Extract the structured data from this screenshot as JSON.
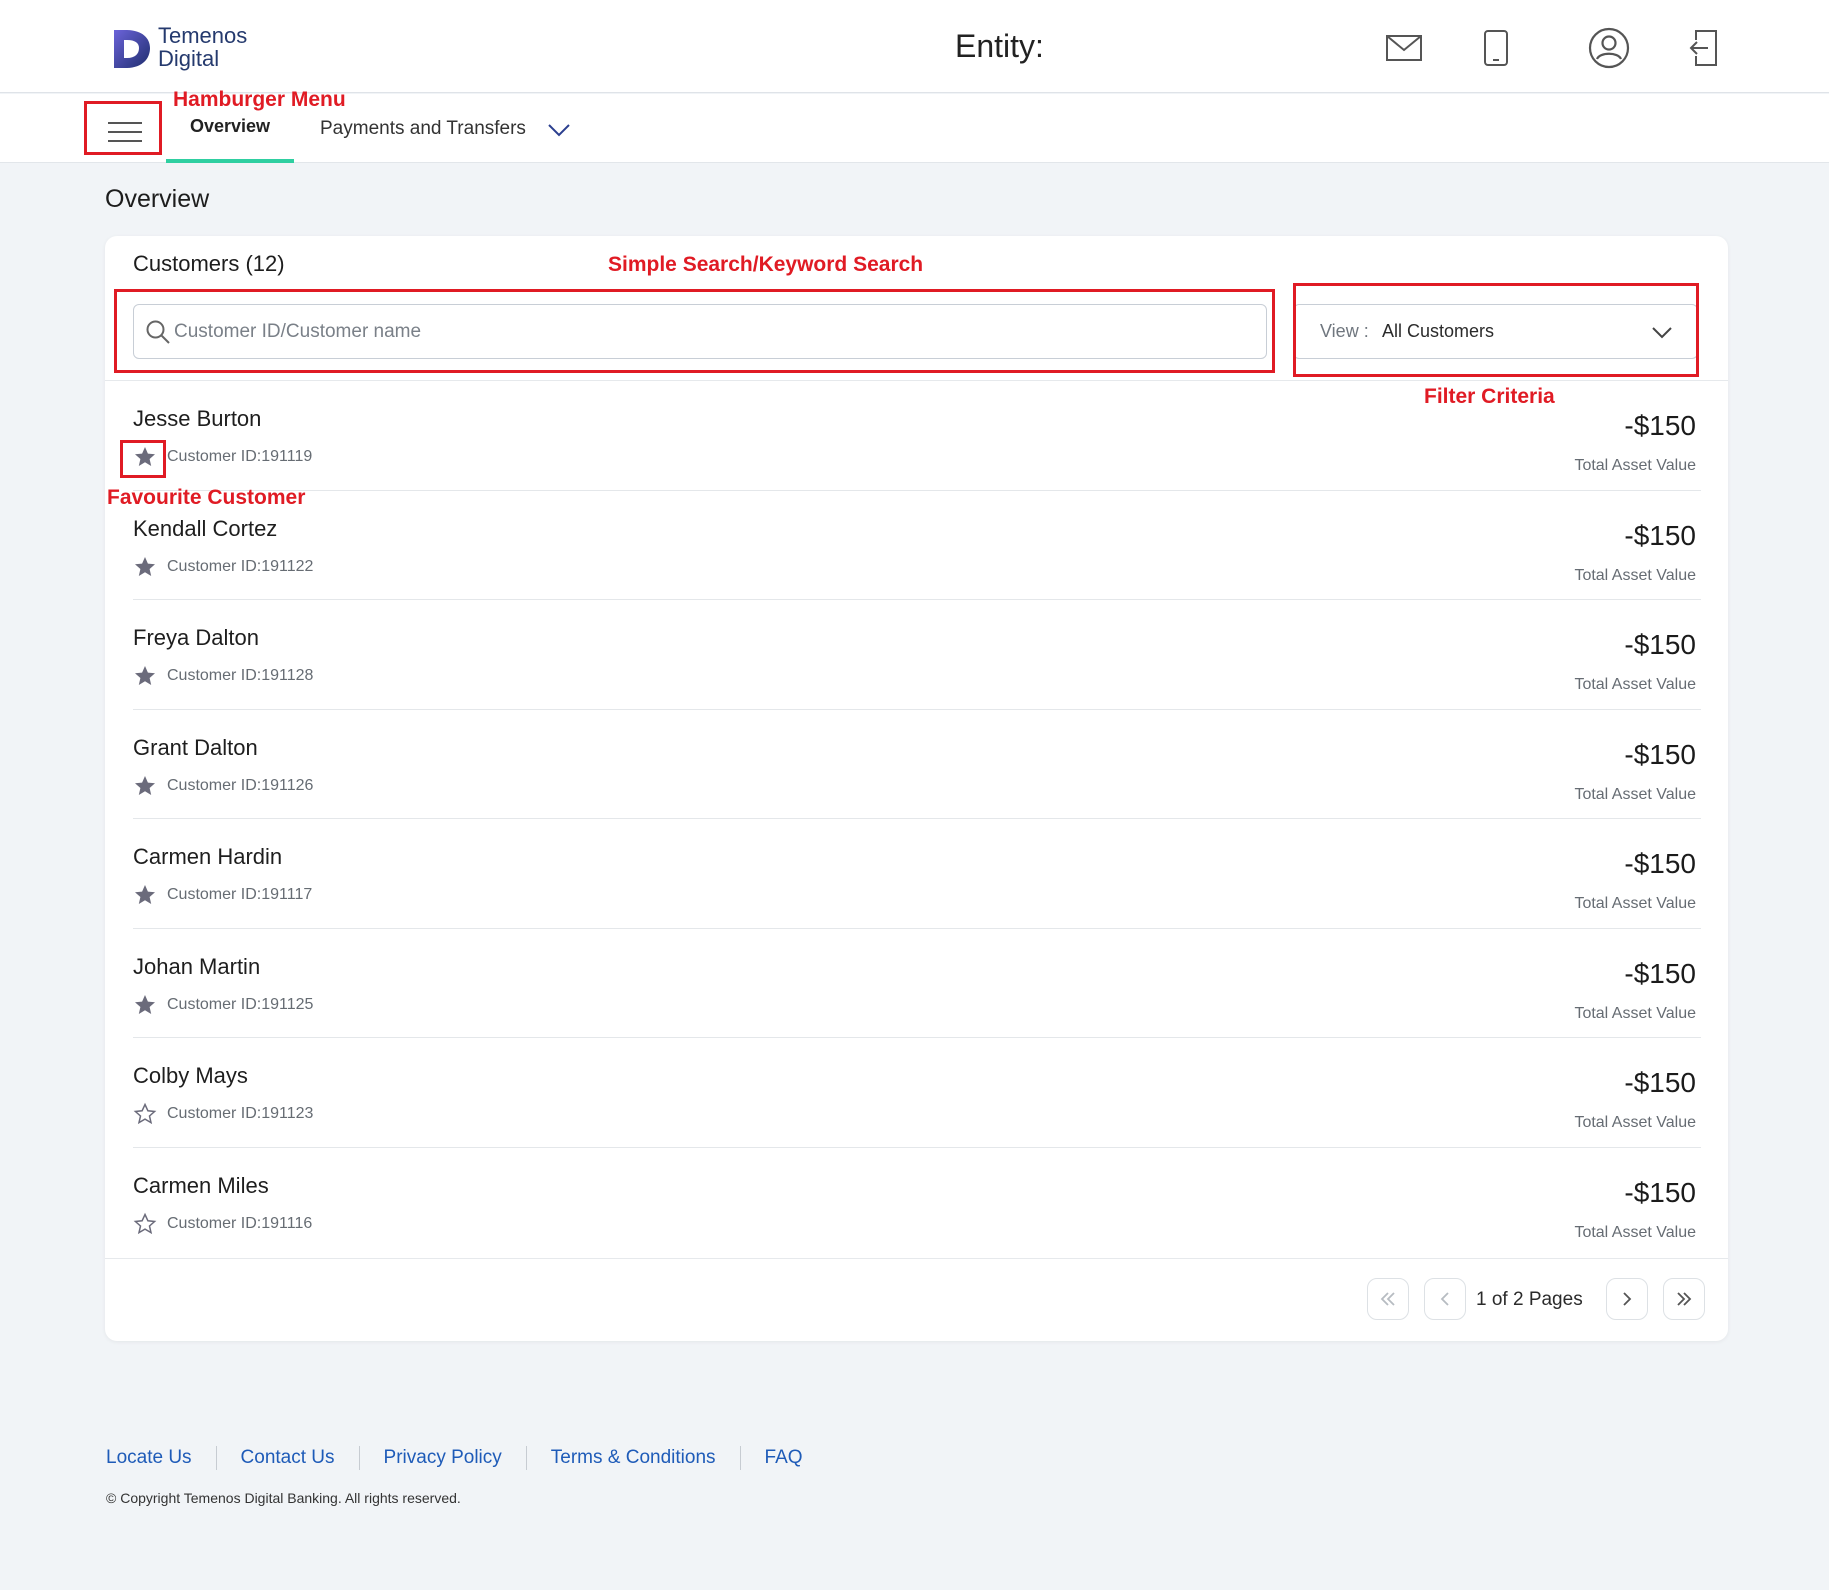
{
  "header": {
    "logo_line1": "Temenos",
    "logo_line2": "Digital",
    "entity_label": "Entity:",
    "icons": [
      "mail-icon",
      "mobile-icon",
      "profile-icon",
      "logout-icon"
    ]
  },
  "nav": {
    "tabs": [
      {
        "label": "Overview",
        "active": true
      },
      {
        "label": "Payments and Transfers",
        "active": false
      }
    ]
  },
  "page_title": "Overview",
  "customers": {
    "title": "Customers (12)",
    "search_placeholder": "Customer ID/Customer name",
    "view_label": "View :",
    "view_value": "All Customers",
    "list": [
      {
        "name": "Jesse Burton",
        "id": "Customer ID:191119",
        "favourite": true,
        "amount": "-$150",
        "amount_label": "Total Asset Value"
      },
      {
        "name": "Kendall Cortez",
        "id": "Customer ID:191122",
        "favourite": true,
        "amount": "-$150",
        "amount_label": "Total Asset Value"
      },
      {
        "name": "Freya Dalton",
        "id": "Customer ID:191128",
        "favourite": true,
        "amount": "-$150",
        "amount_label": "Total Asset Value"
      },
      {
        "name": "Grant Dalton",
        "id": "Customer ID:191126",
        "favourite": true,
        "amount": "-$150",
        "amount_label": "Total Asset Value"
      },
      {
        "name": "Carmen Hardin",
        "id": "Customer ID:191117",
        "favourite": true,
        "amount": "-$150",
        "amount_label": "Total Asset Value"
      },
      {
        "name": "Johan Martin",
        "id": "Customer ID:191125",
        "favourite": true,
        "amount": "-$150",
        "amount_label": "Total Asset Value"
      },
      {
        "name": "Colby Mays",
        "id": "Customer ID:191123",
        "favourite": false,
        "amount": "-$150",
        "amount_label": "Total Asset Value"
      },
      {
        "name": "Carmen Miles",
        "id": "Customer ID:191116",
        "favourite": false,
        "amount": "-$150",
        "amount_label": "Total Asset Value"
      }
    ],
    "pagination": "1 of 2 Pages"
  },
  "annotations": {
    "hamburger": "Hamburger Menu",
    "search": "Simple Search/Keyword Search",
    "filter": "Filter Criteria",
    "favourite": "Favourite Customer",
    "color": "#e01b24"
  },
  "footer": {
    "links": [
      "Locate Us",
      "Contact Us",
      "Privacy Policy",
      "Terms & Conditions",
      "FAQ"
    ],
    "copyright": "© Copyright Temenos Digital Banking. All rights reserved."
  },
  "colors": {
    "accent_tab": "#2fcfa1",
    "link": "#1e5bb8",
    "brand": "#253a6e",
    "star": "#6b6b7b"
  }
}
